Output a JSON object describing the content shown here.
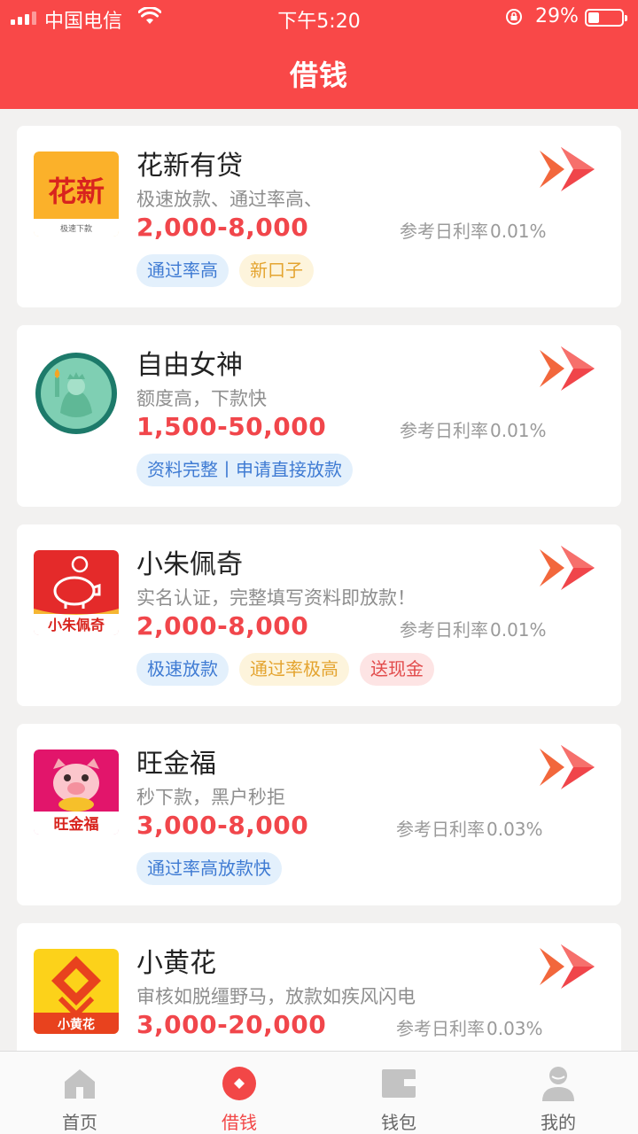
{
  "status_bar": {
    "carrier": "中国电信",
    "time": "下午5:20",
    "battery": "29%"
  },
  "header": {
    "title": "借钱"
  },
  "colors": {
    "brand": "#f94848",
    "amount": "#f1464b",
    "tag_blue": "#3f7bd3",
    "tag_yellow": "#e4a430",
    "tag_red": "#e24b4b"
  },
  "loans": [
    {
      "name": "花新有贷",
      "desc": "极速放款、通过率高、",
      "amount": "2,000-8,000",
      "rate_label": "参考日利率",
      "rate": "0.01%",
      "logo_text": "花新",
      "logo_subtext": "极速下款",
      "tags": [
        {
          "text": "通过率高",
          "color": "blue"
        },
        {
          "text": "新口子",
          "color": "yellow"
        }
      ]
    },
    {
      "name": "自由女神",
      "desc": "额度高，下款快",
      "amount": "1,500-50,000",
      "rate_label": "参考日利率",
      "rate": "0.01%",
      "tags": [
        {
          "text": "资料完整丨申请直接放款",
          "color": "blue"
        }
      ]
    },
    {
      "name": "小朱佩奇",
      "desc": "实名认证，完整填写资料即放款！",
      "amount": "2,000-8,000",
      "rate_label": "参考日利率",
      "rate": "0.01%",
      "logo_text": "小朱佩奇",
      "tags": [
        {
          "text": "极速放款",
          "color": "blue"
        },
        {
          "text": "通过率极高",
          "color": "yellow"
        },
        {
          "text": "送现金",
          "color": "red"
        }
      ]
    },
    {
      "name": "旺金福",
      "desc": "秒下款，黑户秒拒",
      "amount": "3,000-8,000",
      "rate_label": "参考日利率",
      "rate": "0.03%",
      "logo_text": "旺金福",
      "tags": [
        {
          "text": "通过率高放款快",
          "color": "blue"
        }
      ]
    },
    {
      "name": "小黄花",
      "desc": "审核如脱缰野马，放款如疾风闪电",
      "amount": "3,000-20,000",
      "rate_label": "参考日利率",
      "rate": "0.03%",
      "logo_text": "小黄花",
      "tags": []
    }
  ],
  "tabbar": [
    {
      "label": "首页",
      "icon": "home-icon"
    },
    {
      "label": "借钱",
      "icon": "borrow-icon",
      "active": true
    },
    {
      "label": "钱包",
      "icon": "wallet-icon"
    },
    {
      "label": "我的",
      "icon": "profile-icon"
    }
  ]
}
